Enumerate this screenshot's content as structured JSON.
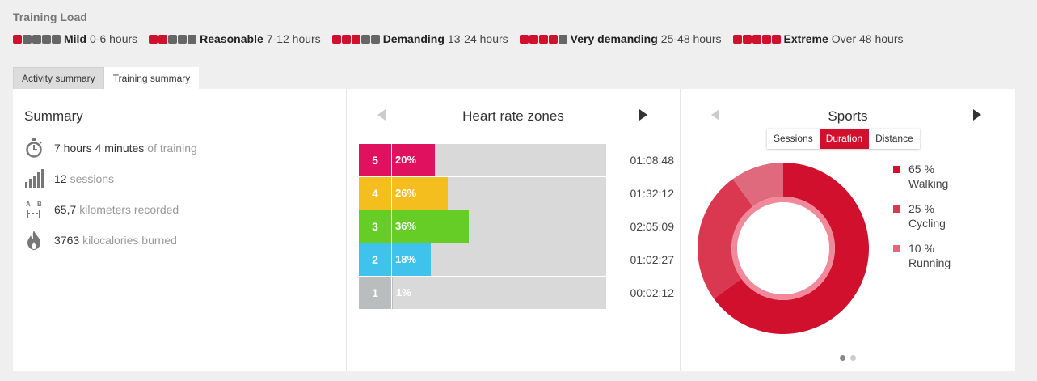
{
  "training_load": {
    "title": "Training Load",
    "levels": [
      {
        "name": "Mild",
        "range": "0-6 hours",
        "filled": 1
      },
      {
        "name": "Reasonable",
        "range": "7-12 hours",
        "filled": 2
      },
      {
        "name": "Demanding",
        "range": "13-24 hours",
        "filled": 3
      },
      {
        "name": "Very demanding",
        "range": "25-48 hours",
        "filled": 4
      },
      {
        "name": "Extreme",
        "range": "Over 48 hours",
        "filled": 5
      }
    ]
  },
  "tabs": [
    {
      "label": "Activity summary",
      "active": false
    },
    {
      "label": "Training summary",
      "active": true
    }
  ],
  "summary": {
    "title": "Summary",
    "items": [
      {
        "icon": "stopwatch-icon",
        "value": "7 hours 4 minutes",
        "text": "of training"
      },
      {
        "icon": "bar-chart-icon",
        "value": "12",
        "text": "sessions"
      },
      {
        "icon": "distance-ab-icon",
        "value": "65,7",
        "text": "kilometers recorded"
      },
      {
        "icon": "flame-icon",
        "value": "3763",
        "text": "kilocalories burned"
      }
    ]
  },
  "heart_rate": {
    "title": "Heart rate zones",
    "zones": [
      {
        "zone": "5",
        "percent": "20%",
        "fraction": 0.2,
        "time": "01:08:48",
        "color": "#e0115f"
      },
      {
        "zone": "4",
        "percent": "26%",
        "fraction": 0.26,
        "time": "01:32:12",
        "color": "#f5be1f"
      },
      {
        "zone": "3",
        "percent": "36%",
        "fraction": 0.36,
        "time": "02:05:09",
        "color": "#66cc26"
      },
      {
        "zone": "2",
        "percent": "18%",
        "fraction": 0.18,
        "time": "01:02:27",
        "color": "#3fc2ec"
      },
      {
        "zone": "1",
        "percent": "1%",
        "fraction": 0.01,
        "time": "00:02:12",
        "color": "#b9bdbd"
      }
    ]
  },
  "sports": {
    "title": "Sports",
    "segments": [
      {
        "label": "Sessions",
        "active": false
      },
      {
        "label": "Duration",
        "active": true
      },
      {
        "label": "Distance",
        "active": false
      }
    ],
    "items": [
      {
        "percent": "65 %",
        "name": "Walking",
        "value": 65,
        "color": "#d0102d"
      },
      {
        "percent": "25 %",
        "name": "Cycling",
        "value": 25,
        "color": "#d93850"
      },
      {
        "percent": "10 %",
        "name": "Running",
        "value": 10,
        "color": "#e06a7d"
      }
    ],
    "page_count": 2,
    "active_page": 0
  },
  "colors": {
    "accent": "#d0102d",
    "block_off": "#666666"
  }
}
